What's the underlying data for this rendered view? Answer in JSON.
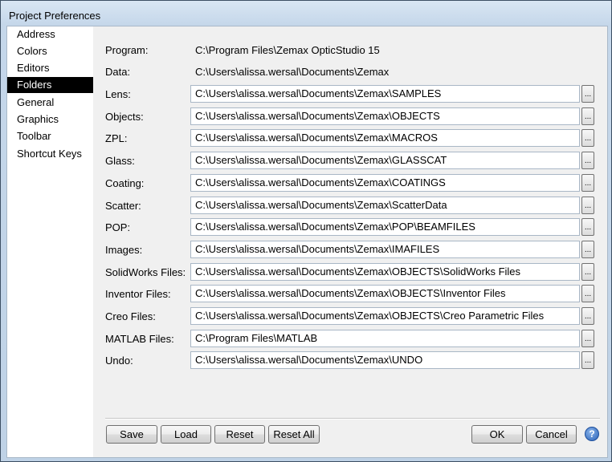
{
  "window": {
    "title": "Project Preferences"
  },
  "sidebar": {
    "items": [
      {
        "label": "Address"
      },
      {
        "label": "Colors"
      },
      {
        "label": "Editors"
      },
      {
        "label": "Folders"
      },
      {
        "label": "General"
      },
      {
        "label": "Graphics"
      },
      {
        "label": "Toolbar"
      },
      {
        "label": "Shortcut Keys"
      }
    ],
    "selected": "Folders"
  },
  "folders": {
    "program": {
      "label": "Program:",
      "value": "C:\\Program Files\\Zemax OpticStudio 15"
    },
    "data": {
      "label": "Data:",
      "value": "C:\\Users\\alissa.wersal\\Documents\\Zemax"
    },
    "paths": [
      {
        "label": "Lens:",
        "value": "C:\\Users\\alissa.wersal\\Documents\\Zemax\\SAMPLES"
      },
      {
        "label": "Objects:",
        "value": "C:\\Users\\alissa.wersal\\Documents\\Zemax\\OBJECTS"
      },
      {
        "label": "ZPL:",
        "value": "C:\\Users\\alissa.wersal\\Documents\\Zemax\\MACROS"
      },
      {
        "label": "Glass:",
        "value": "C:\\Users\\alissa.wersal\\Documents\\Zemax\\GLASSCAT"
      },
      {
        "label": "Coating:",
        "value": "C:\\Users\\alissa.wersal\\Documents\\Zemax\\COATINGS"
      },
      {
        "label": "Scatter:",
        "value": "C:\\Users\\alissa.wersal\\Documents\\Zemax\\ScatterData"
      },
      {
        "label": "POP:",
        "value": "C:\\Users\\alissa.wersal\\Documents\\Zemax\\POP\\BEAMFILES"
      },
      {
        "label": "Images:",
        "value": "C:\\Users\\alissa.wersal\\Documents\\Zemax\\IMAFILES"
      },
      {
        "label": "SolidWorks Files:",
        "value": "C:\\Users\\alissa.wersal\\Documents\\Zemax\\OBJECTS\\SolidWorks Files"
      },
      {
        "label": "Inventor Files:",
        "value": "C:\\Users\\alissa.wersal\\Documents\\Zemax\\OBJECTS\\Inventor Files"
      },
      {
        "label": "Creo Files:",
        "value": "C:\\Users\\alissa.wersal\\Documents\\Zemax\\OBJECTS\\Creo Parametric Files"
      },
      {
        "label": "MATLAB Files:",
        "value": "C:\\Program Files\\MATLAB"
      },
      {
        "label": "Undo:",
        "value": "C:\\Users\\alissa.wersal\\Documents\\Zemax\\UNDO"
      }
    ],
    "browse_label": "..."
  },
  "buttons": {
    "save": "Save",
    "load": "Load",
    "reset": "Reset",
    "reset_all": "Reset All",
    "ok": "OK",
    "cancel": "Cancel",
    "help": "?"
  }
}
